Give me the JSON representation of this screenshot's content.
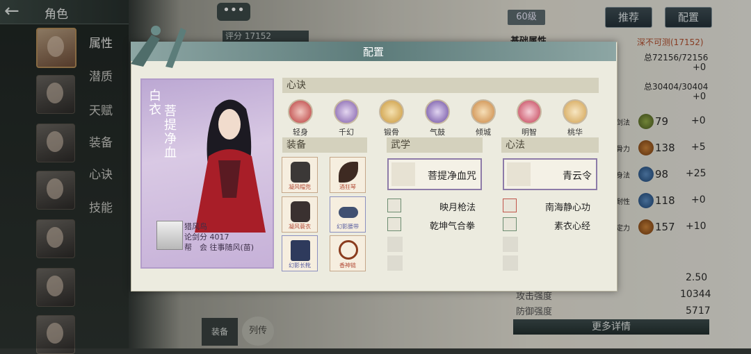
{
  "header": {
    "back_icon": "back-arrow-icon",
    "title": "角色"
  },
  "side_tabs": [
    "属性",
    "潜质",
    "天赋",
    "装备",
    "心诀",
    "技能"
  ],
  "top_buttons": {
    "level": "60级",
    "recommend": "推荐",
    "config": "配置"
  },
  "score_chip": {
    "label": "评分",
    "value": "17152"
  },
  "right_panel": {
    "section_title": "基础属性",
    "grade": "深不可测(17152)",
    "hp": "总72156/72156",
    "hp_delta": "+0",
    "mp": "总30404/30404",
    "mp_delta": "+0",
    "stats": [
      {
        "tag": "剑法",
        "value": "79",
        "delta": "+0"
      },
      {
        "tag": "骨力",
        "value": "138",
        "delta": "+5"
      },
      {
        "tag": "身法",
        "value": "98",
        "delta": "+25"
      },
      {
        "tag": "耐性",
        "value": "118",
        "delta": "+0"
      },
      {
        "tag": "定力",
        "value": "157",
        "delta": "+10"
      }
    ],
    "extra_value": "2.50",
    "attack_label": "攻击强度",
    "attack_value": "10344",
    "defense_label": "防御强度",
    "defense_value": "5717",
    "more_button": "更多详情"
  },
  "bottom_tabs": {
    "story": "列传",
    "label_a": "装备"
  },
  "modal": {
    "title": "配置",
    "character": {
      "surname": "白衣",
      "name": "菩提净血",
      "player_name": "猎风鸟",
      "sword_score": "论剑分 4017",
      "guild": "帮　会 往事随风(苗)"
    },
    "xinjue": {
      "header": "心诀",
      "items": [
        {
          "label": "轻身",
          "color": "#b83a3a"
        },
        {
          "label": "千幻",
          "color": "#7d5aa8"
        },
        {
          "label": "锻骨",
          "color": "#c8963a"
        },
        {
          "label": "气鼓",
          "color": "#6b4aa0"
        },
        {
          "label": "倾城",
          "color": "#c98440"
        },
        {
          "label": "明智",
          "color": "#c23c52"
        },
        {
          "label": "桃华",
          "color": "#d1a04e"
        }
      ]
    },
    "equip": {
      "header": "装备",
      "items": [
        {
          "label": "凝风帽兜",
          "color": "#3b3837"
        },
        {
          "label": "酒狂琴",
          "color": "#3e2a22"
        },
        {
          "label": "凝风蓑衣",
          "color": "#3a3130"
        },
        {
          "label": "幻影腰带",
          "color": "#405071"
        },
        {
          "label": "幻影长靴",
          "color": "#2e3a5c"
        },
        {
          "label": "香神链",
          "color": "#8a3c1e"
        }
      ]
    },
    "wuxue": {
      "header": "武学",
      "main": "菩提净血咒",
      "subs": [
        "映月枪法",
        "乾坤气合拳"
      ]
    },
    "xinfa": {
      "header": "心法",
      "main": "青云令",
      "subs": [
        "南海静心功",
        "素衣心经"
      ]
    }
  }
}
